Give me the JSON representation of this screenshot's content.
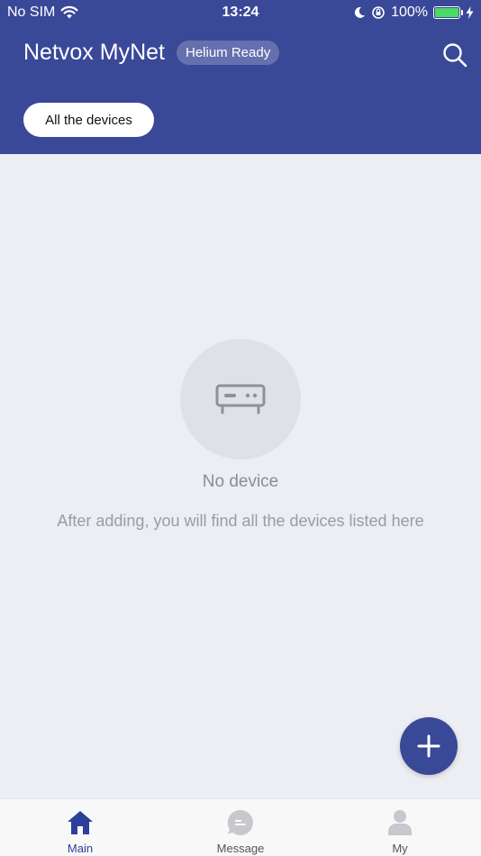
{
  "status_bar": {
    "carrier": "No SIM",
    "time": "13:24",
    "battery": "100%"
  },
  "header": {
    "title": "Netvox MyNet",
    "badge": "Helium Ready",
    "filter_label": "All the devices"
  },
  "empty_state": {
    "title": "No device",
    "description": "After adding, you will find all the devices listed here"
  },
  "tabs": [
    {
      "label": "Main",
      "icon": "home-icon",
      "active": true
    },
    {
      "label": "Message",
      "icon": "message-icon",
      "active": false
    },
    {
      "label": "My",
      "icon": "person-icon",
      "active": false
    }
  ],
  "colors": {
    "primary": "#3a4898",
    "background": "#eceef3",
    "tab_active": "#2e3f9a",
    "tab_inactive": "#c6c8ce"
  }
}
